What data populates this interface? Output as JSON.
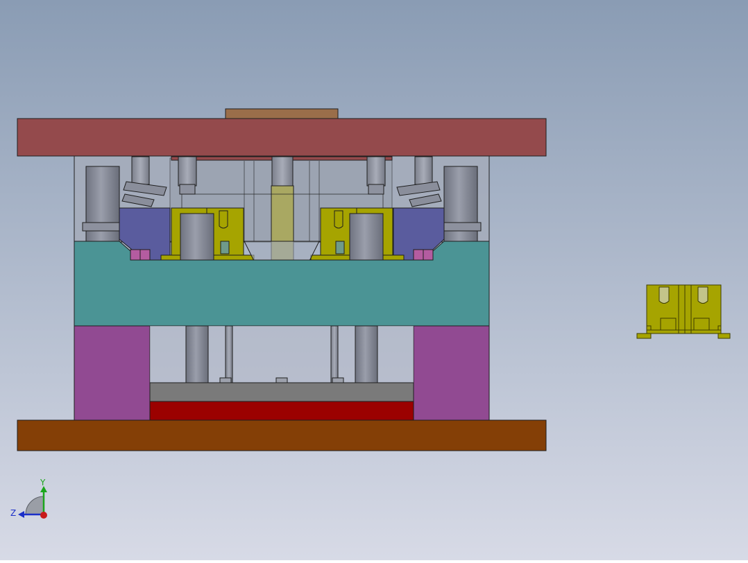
{
  "viewport": {
    "background_top": "#8A9CB4",
    "background_bottom": "#D7DAE6"
  },
  "colors": {
    "top_clamp_plate": "#944A4C",
    "locating_ring": "#9A6E4A",
    "cavity_plate_frame": "#A4ACBA",
    "core_plate": "#4B9495",
    "spacer_block": "#914A92",
    "ejector_retainer": "#7A7A7A",
    "ejector_plate": "#9B0100",
    "bottom_clamp_plate": "#843F06",
    "slider": "#5A5C9E",
    "guide_pillar": "#808492",
    "product_part": "#A6A400",
    "product_outline": "#3D3D00",
    "wedge_block": "#B45CA0",
    "edge_line": "#1E1E1E"
  },
  "triad": {
    "y_label": "Y",
    "z_label": "Z",
    "y_color": "#1BA61B",
    "z_color": "#1B2FC8",
    "x_color": "#C81B1B"
  },
  "icons": [
    "coordinate-triad-icon"
  ]
}
